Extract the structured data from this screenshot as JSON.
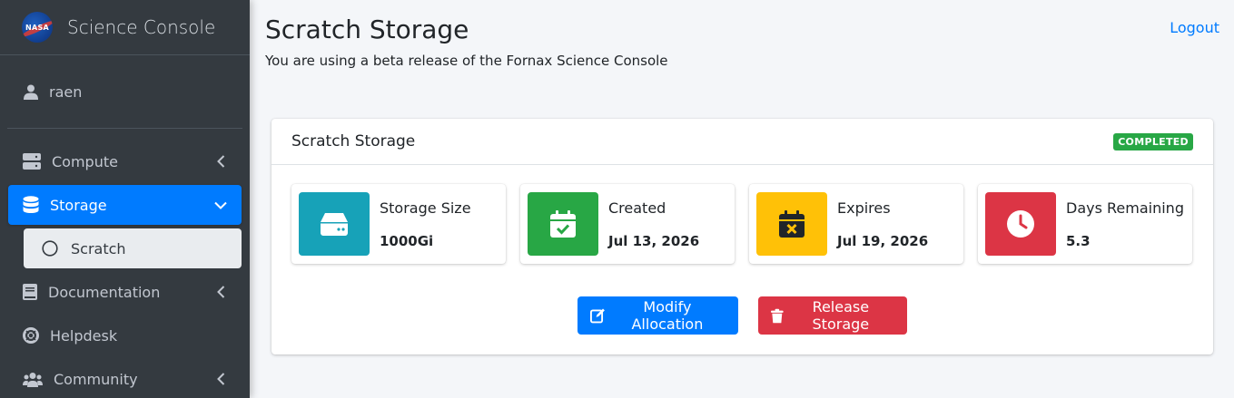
{
  "sidebar": {
    "brand": {
      "logo_text": "NASA",
      "title": "Science Console"
    },
    "user": {
      "name": "raen"
    },
    "items": [
      {
        "label": "Compute",
        "icon": "server-icon",
        "expanded": false
      },
      {
        "label": "Storage",
        "icon": "database-icon",
        "expanded": true,
        "active": true
      },
      {
        "label": "Documentation",
        "icon": "book-icon",
        "expanded": false
      },
      {
        "label": "Helpdesk",
        "icon": "lifering-icon"
      },
      {
        "label": "Community",
        "icon": "users-icon",
        "expanded": false
      }
    ],
    "subitems": [
      {
        "label": "Scratch",
        "icon": "circle-icon"
      }
    ]
  },
  "header": {
    "title": "Scratch Storage",
    "subtitle": "You are using a beta release of the Fornax Science Console",
    "logout": "Logout"
  },
  "card": {
    "title": "Scratch Storage",
    "status": "COMPLETED",
    "status_color": "#28a745",
    "boxes": [
      {
        "label": "Storage Size",
        "value": "1000Gi",
        "color": "#17a2b8",
        "icon": "hdd-icon"
      },
      {
        "label": "Created",
        "value": "Jul 13, 2026",
        "color": "#28a745",
        "icon": "calendar-check-icon"
      },
      {
        "label": "Expires",
        "value": "Jul 19, 2026",
        "color": "#ffc107",
        "icon": "calendar-x-icon"
      },
      {
        "label": "Days Remaining",
        "value": "5.3",
        "color": "#dc3545",
        "icon": "clock-icon"
      }
    ],
    "actions": {
      "modify": "Modify Allocation",
      "release": "Release Storage"
    }
  }
}
